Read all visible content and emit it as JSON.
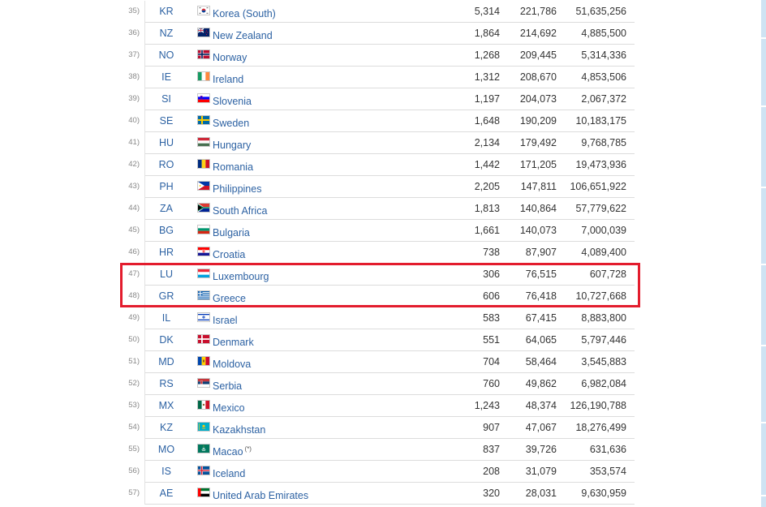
{
  "table": {
    "rows": [
      {
        "rank": "35)",
        "code": "KR",
        "flag": "kr-flag-icon",
        "name": "Korea (South)",
        "note": "",
        "v1": "5,314",
        "v2": "221,786",
        "v3": "51,635,256"
      },
      {
        "rank": "36)",
        "code": "NZ",
        "flag": "nz-flag-icon",
        "name": "New Zealand",
        "note": "",
        "v1": "1,864",
        "v2": "214,692",
        "v3": "4,885,500"
      },
      {
        "rank": "37)",
        "code": "NO",
        "flag": "no-flag-icon",
        "name": "Norway",
        "note": "",
        "v1": "1,268",
        "v2": "209,445",
        "v3": "5,314,336"
      },
      {
        "rank": "38)",
        "code": "IE",
        "flag": "ie-flag-icon",
        "name": "Ireland",
        "note": "",
        "v1": "1,312",
        "v2": "208,670",
        "v3": "4,853,506"
      },
      {
        "rank": "39)",
        "code": "SI",
        "flag": "si-flag-icon",
        "name": "Slovenia",
        "note": "",
        "v1": "1,197",
        "v2": "204,073",
        "v3": "2,067,372"
      },
      {
        "rank": "40)",
        "code": "SE",
        "flag": "se-flag-icon",
        "name": "Sweden",
        "note": "",
        "v1": "1,648",
        "v2": "190,209",
        "v3": "10,183,175"
      },
      {
        "rank": "41)",
        "code": "HU",
        "flag": "hu-flag-icon",
        "name": "Hungary",
        "note": "",
        "v1": "2,134",
        "v2": "179,492",
        "v3": "9,768,785"
      },
      {
        "rank": "42)",
        "code": "RO",
        "flag": "ro-flag-icon",
        "name": "Romania",
        "note": "",
        "v1": "1,442",
        "v2": "171,205",
        "v3": "19,473,936"
      },
      {
        "rank": "43)",
        "code": "PH",
        "flag": "ph-flag-icon",
        "name": "Philippines",
        "note": "",
        "v1": "2,205",
        "v2": "147,811",
        "v3": "106,651,922"
      },
      {
        "rank": "44)",
        "code": "ZA",
        "flag": "za-flag-icon",
        "name": "South Africa",
        "note": "",
        "v1": "1,813",
        "v2": "140,864",
        "v3": "57,779,622"
      },
      {
        "rank": "45)",
        "code": "BG",
        "flag": "bg-flag-icon",
        "name": "Bulgaria",
        "note": "",
        "v1": "1,661",
        "v2": "140,073",
        "v3": "7,000,039"
      },
      {
        "rank": "46)",
        "code": "HR",
        "flag": "hr-flag-icon",
        "name": "Croatia",
        "note": "",
        "v1": "738",
        "v2": "87,907",
        "v3": "4,089,400"
      },
      {
        "rank": "47)",
        "code": "LU",
        "flag": "lu-flag-icon",
        "name": "Luxembourg",
        "note": "",
        "v1": "306",
        "v2": "76,515",
        "v3": "607,728"
      },
      {
        "rank": "48)",
        "code": "GR",
        "flag": "gr-flag-icon",
        "name": "Greece",
        "note": "",
        "v1": "606",
        "v2": "76,418",
        "v3": "10,727,668"
      },
      {
        "rank": "49)",
        "code": "IL",
        "flag": "il-flag-icon",
        "name": "Israel",
        "note": "",
        "v1": "583",
        "v2": "67,415",
        "v3": "8,883,800"
      },
      {
        "rank": "50)",
        "code": "DK",
        "flag": "dk-flag-icon",
        "name": "Denmark",
        "note": "",
        "v1": "551",
        "v2": "64,065",
        "v3": "5,797,446"
      },
      {
        "rank": "51)",
        "code": "MD",
        "flag": "md-flag-icon",
        "name": "Moldova",
        "note": "",
        "v1": "704",
        "v2": "58,464",
        "v3": "3,545,883"
      },
      {
        "rank": "52)",
        "code": "RS",
        "flag": "rs-flag-icon",
        "name": "Serbia",
        "note": "",
        "v1": "760",
        "v2": "49,862",
        "v3": "6,982,084"
      },
      {
        "rank": "53)",
        "code": "MX",
        "flag": "mx-flag-icon",
        "name": "Mexico",
        "note": "",
        "v1": "1,243",
        "v2": "48,374",
        "v3": "126,190,788"
      },
      {
        "rank": "54)",
        "code": "KZ",
        "flag": "kz-flag-icon",
        "name": "Kazakhstan",
        "note": "",
        "v1": "907",
        "v2": "47,067",
        "v3": "18,276,499"
      },
      {
        "rank": "55)",
        "code": "MO",
        "flag": "mo-flag-icon",
        "name": "Macao",
        "note": "(*)",
        "v1": "837",
        "v2": "39,726",
        "v3": "631,636"
      },
      {
        "rank": "56)",
        "code": "IS",
        "flag": "is-flag-icon",
        "name": "Iceland",
        "note": "",
        "v1": "208",
        "v2": "31,079",
        "v3": "353,574"
      },
      {
        "rank": "57)",
        "code": "AE",
        "flag": "ae-flag-icon",
        "name": "United Arab Emirates",
        "note": "",
        "v1": "320",
        "v2": "28,031",
        "v3": "9,630,959"
      }
    ]
  },
  "colors": {
    "link": "#2d62a3",
    "highlight_border": "#e31c2d",
    "row_separator": "#dcdcdc",
    "edge_bar": "#cfe3f3"
  }
}
